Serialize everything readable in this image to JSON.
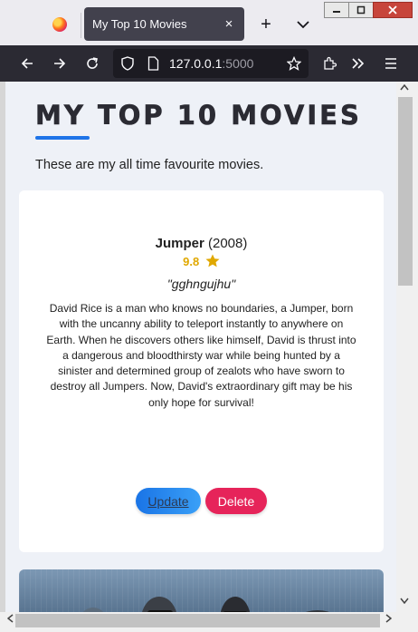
{
  "browser": {
    "tab_title": "My Top 10 Movies",
    "tab_close_icon": "×",
    "new_tab_icon": "+",
    "url_host": "127.0.0.1",
    "url_port": ":5000"
  },
  "page": {
    "title": "MY TOP 10 MOVIES",
    "subtitle": "These are my all time favourite movies."
  },
  "movies": [
    {
      "title": "Jumper",
      "year": "(2008)",
      "rating": "9.8",
      "review": "\"gghngujhu\"",
      "description": "David Rice is a man who knows no boundaries, a Jumper, born with the uncanny ability to teleport instantly to anywhere on Earth. When he discovers others like himself, David is thrust into a dangerous and bloodthirsty war while being hunted by a sinister and determined group of zealots who have sworn to destroy all Jumpers. Now, David's extraordinary gift may be his only hope for survival!",
      "update_label": "Update",
      "delete_label": "Delete"
    }
  ],
  "colors": {
    "accent": "#1e74e8",
    "delete": "#e6245a",
    "rating": "#e0a800"
  }
}
